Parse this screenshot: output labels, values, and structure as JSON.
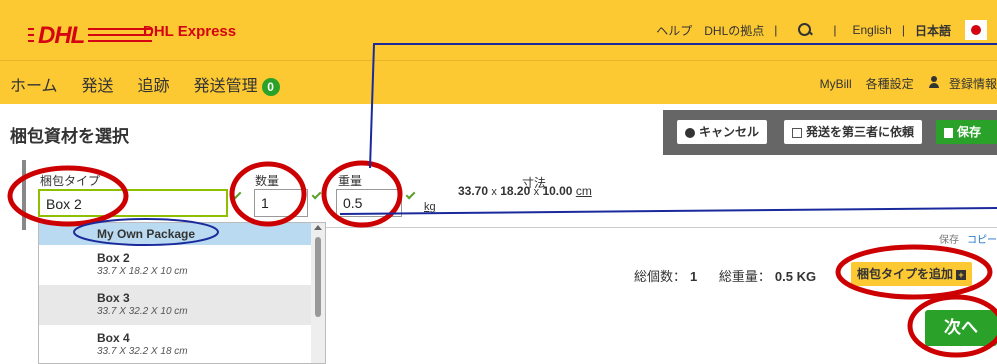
{
  "header": {
    "logo_text": "DHL",
    "brand": "DHL Express",
    "util_links": [
      "ヘルプ",
      "DHLの拠点"
    ],
    "lang_english": "English",
    "lang_japanese": "日本語"
  },
  "nav": {
    "items": [
      "ホーム",
      "発送",
      "追跡",
      "発送管理"
    ],
    "shipment_count": "0",
    "right": [
      "MyBill",
      "各種設定",
      "登録情報"
    ]
  },
  "page": {
    "title": "梱包資材を選択"
  },
  "actions": {
    "cancel": "キャンセル",
    "third_party": "発送を第三者に依頼",
    "save": "保存"
  },
  "form": {
    "package_type_label": "梱包タイプ",
    "package_type_value": "Box 2",
    "quantity_label": "数量",
    "quantity_value": "1",
    "weight_label": "重量",
    "weight_value": "0.5",
    "weight_unit": "kg",
    "dims_label": "寸法",
    "dims": {
      "length": "33.70",
      "width": "18.20",
      "height": "10.00",
      "sep": "x",
      "unit": "cm"
    }
  },
  "dropdown": {
    "options": [
      {
        "name": "My Own Package",
        "sub": ""
      },
      {
        "name": "Box 2",
        "sub": "33.7 X 18.2 X 10 cm"
      },
      {
        "name": "Box 3",
        "sub": "33.7 X 32.2 X 10 cm"
      },
      {
        "name": "Box 4",
        "sub": "33.7 X 32.2 X 18 cm"
      }
    ]
  },
  "row_links": {
    "save": "保存",
    "copy": "コピー"
  },
  "totals": {
    "count_label": "総個数：",
    "count_value": "1",
    "weight_label": "総重量：",
    "weight_value": "0.5 KG"
  },
  "buttons": {
    "add_package": "梱包タイプを追加",
    "next": "次へ"
  },
  "colors": {
    "dhl_yellow": "#fcc933",
    "dhl_red": "#d40511",
    "green": "#2aa22a",
    "annotation_red": "#cc0000",
    "annotation_blue": "#1a2a9c"
  }
}
